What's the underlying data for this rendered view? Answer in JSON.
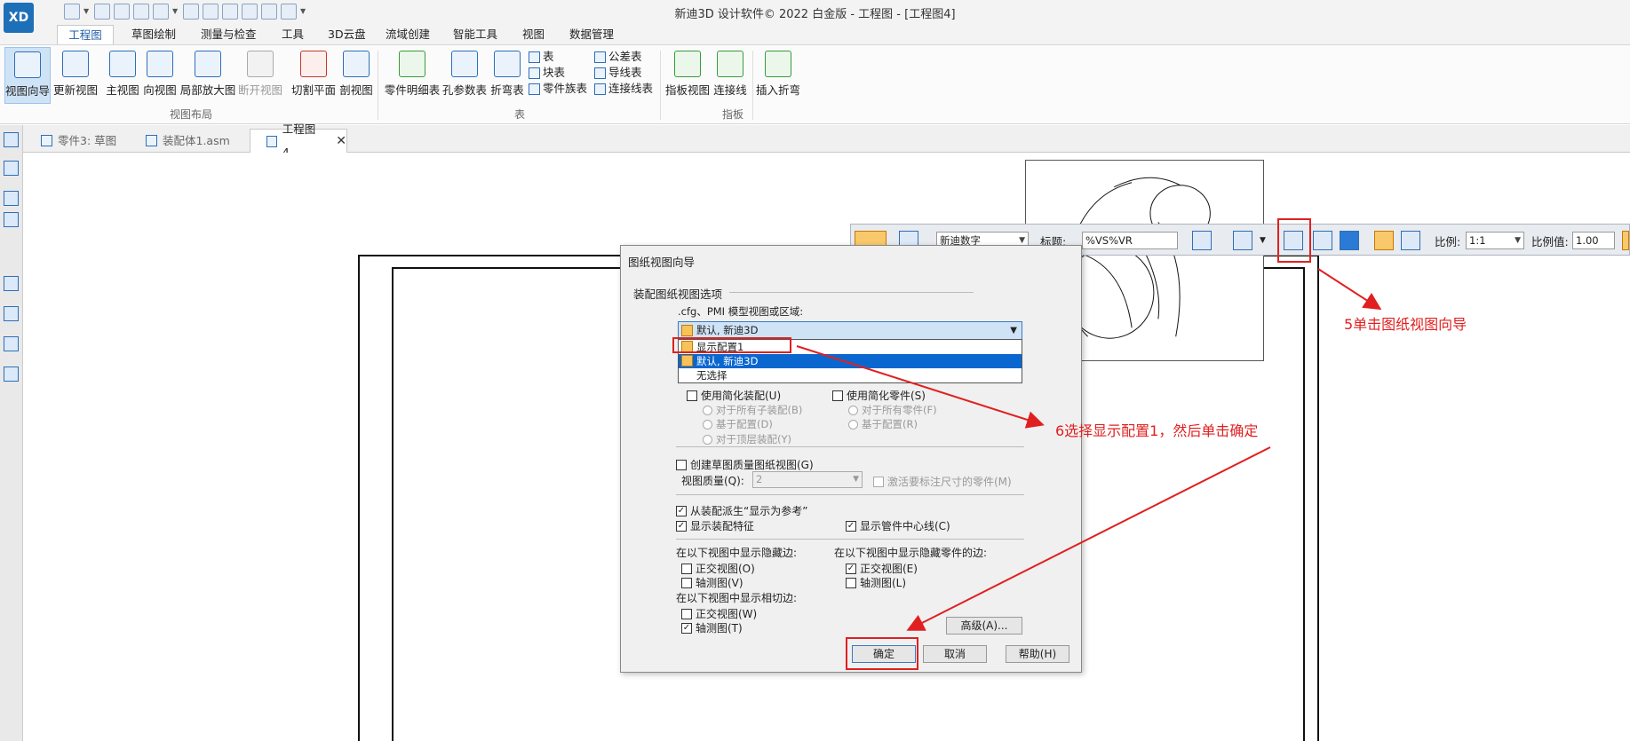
{
  "app": {
    "logo": "XD",
    "title": "新迪3D 设计软件© 2022 白金版 - 工程图 - [工程图4]"
  },
  "tabs": [
    "工程图",
    "草图绘制",
    "测量与检查",
    "工具",
    "3D云盘",
    "流域创建",
    "智能工具",
    "视图",
    "数据管理"
  ],
  "ribbon": {
    "buttons": [
      "视图向导",
      "更新视图",
      "主视图",
      "向视图",
      "局部放大图",
      "断开视图",
      "切割平面",
      "剖视图",
      "零件明细表",
      "孔参数表",
      "折弯表",
      "指板视图",
      "连接线",
      "插入折弯"
    ],
    "table_list1": [
      "表",
      "块表",
      "零件族表"
    ],
    "table_list2": [
      "公差表",
      "导线表",
      "连接线表"
    ],
    "groups": [
      "视图布局",
      "表",
      "指板"
    ]
  },
  "doctabs": [
    "零件3: 草图",
    "装配体1.asm",
    "工程图4"
  ],
  "viewtoolbar": {
    "style_select": "新迪数字",
    "title_label": "标题:",
    "title_value": "%VS%VR",
    "scale_label": "比例:",
    "scale_value": "1:1",
    "scale_val_label": "比例值:",
    "scale_val": "1.00"
  },
  "dialog": {
    "title": "图纸视图向导",
    "section": "装配图纸视图选项",
    "sub": ".cfg、PMI 模型视图或区域:",
    "combo_value": "默认, 新迪3D",
    "dropdown": [
      "显示配置1",
      "默认, 新迪3D",
      "无选择"
    ],
    "simplified_assembly": "使用简化装配(U)",
    "simplified_part": "使用简化零件(S)",
    "radios_left": [
      "对于所有子装配(B)",
      "基于配置(D)",
      "对于顶层装配(Y)"
    ],
    "radios_right": [
      "对于所有零件(F)",
      "基于配置(R)"
    ],
    "create_draft": "创建草图质量图纸视图(G)",
    "view_quality_label": "视图质量(Q):",
    "view_quality_value": "2",
    "activate_parts": "激活要标注尺寸的零件(M)",
    "derive_ref": "从装配派生“显示为参考”",
    "show_features": "显示装配特征",
    "show_centerline": "显示管件中心线(C)",
    "hidden_edges_label": "在以下视图中显示隐藏边:",
    "hidden_parts_label": "在以下视图中显示隐藏零件的边:",
    "ortho_o": "正交视图(O)",
    "axo_v": "轴测图(V)",
    "ortho_e": "正交视图(E)",
    "axo_l": "轴测图(L)",
    "tangent_label": "在以下视图中显示相切边:",
    "ortho_w": "正交视图(W)",
    "axo_t": "轴测图(T)",
    "advanced": "高级(A)...",
    "ok": "确定",
    "cancel": "取消",
    "help": "帮助(H)"
  },
  "annotations": {
    "step5": "5单击图纸视图向导",
    "step6": "6选择显示配置1，然后单击确定"
  },
  "colors": {
    "annotation": "#e02020",
    "accent": "#1f5fa8",
    "selection": "#0b67d0"
  }
}
